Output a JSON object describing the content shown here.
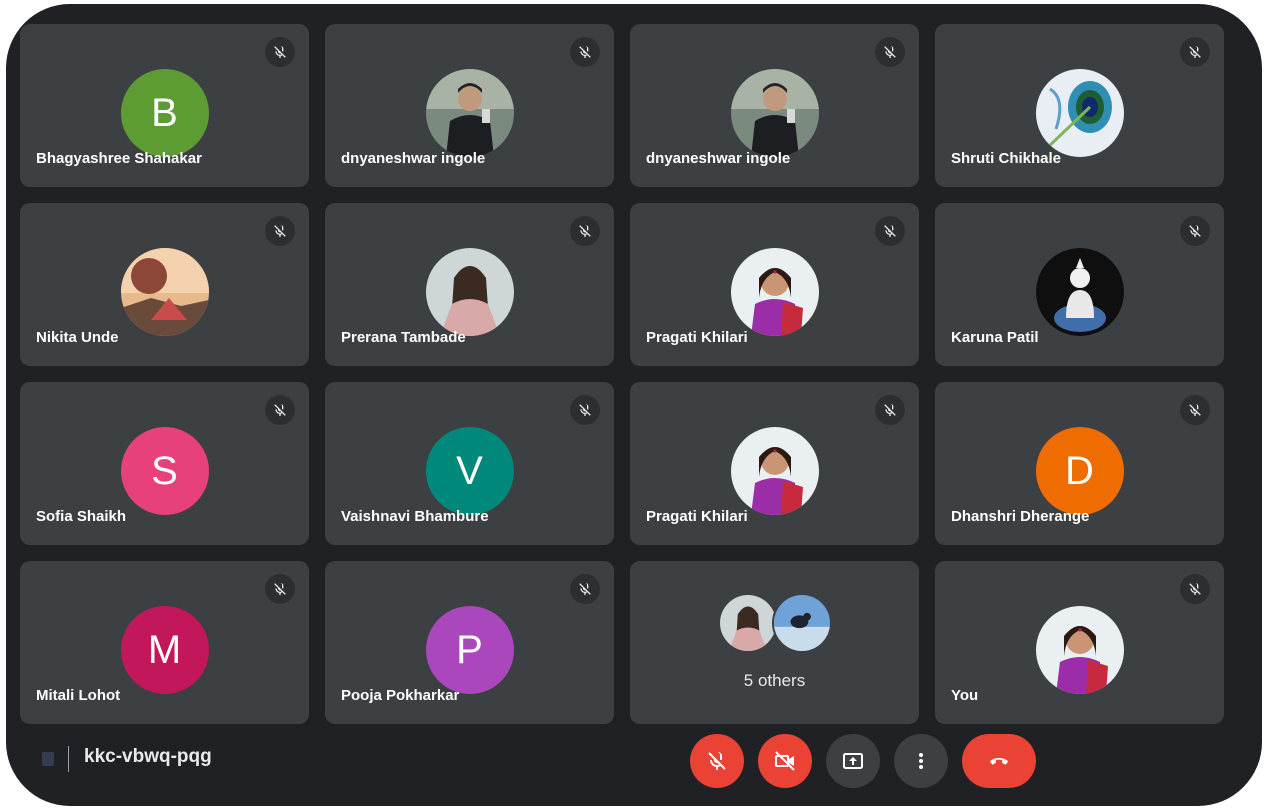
{
  "meeting": {
    "code": "kkc-vbwq-pqg"
  },
  "colors": {
    "background": "#202124",
    "tile": "#3c4043",
    "danger": "#ea4335"
  },
  "participants": [
    {
      "name": "Bhagyashree Shahakar",
      "initial": "B",
      "avatar_color": "#5d9c33",
      "muted": true
    },
    {
      "name": "dnyaneshwar ingole",
      "photo": "photo-man",
      "muted": true
    },
    {
      "name": "dnyaneshwar ingole",
      "photo": "photo-man",
      "muted": true
    },
    {
      "name": "Shruti Chikhale",
      "photo": "photo-peacock-feather",
      "muted": true
    },
    {
      "name": "Nikita Unde",
      "photo": "photo-landscape",
      "muted": true
    },
    {
      "name": "Prerana Tambade",
      "photo": "photo-girl",
      "muted": true
    },
    {
      "name": "Pragati Khilari",
      "photo": "photo-woman-saree",
      "muted": true
    },
    {
      "name": "Karuna Patil",
      "photo": "photo-buddha-statue",
      "muted": true
    },
    {
      "name": "Sofia Shaikh",
      "initial": "S",
      "avatar_color": "#e8407a",
      "muted": true
    },
    {
      "name": "Vaishnavi Bhambure",
      "initial": "V",
      "avatar_color": "#00897b",
      "muted": true
    },
    {
      "name": "Pragati Khilari",
      "photo": "photo-woman-saree",
      "muted": true
    },
    {
      "name": "Dhanshri Dherange",
      "initial": "D",
      "avatar_color": "#ef6c00",
      "muted": true
    },
    {
      "name": "Mitali Lohot",
      "initial": "M",
      "avatar_color": "#c2185b",
      "muted": true
    },
    {
      "name": "Pooja Pokharkar",
      "initial": "P",
      "avatar_color": "#ab47bc",
      "muted": true
    }
  ],
  "others": {
    "label": "5 others",
    "photos": [
      "photo-girl",
      "photo-bird"
    ]
  },
  "self": {
    "name": "You",
    "photo": "photo-woman-saree",
    "muted": true
  },
  "controls": [
    {
      "name": "microphone-off-button",
      "icon": "mic-off-icon"
    },
    {
      "name": "camera-off-button",
      "icon": "camera-off-icon"
    },
    {
      "name": "present-screen-button",
      "icon": "present-icon"
    },
    {
      "name": "more-options-button",
      "icon": "more-vert-icon"
    },
    {
      "name": "leave-call-button",
      "icon": "phone-hangup-icon"
    }
  ]
}
